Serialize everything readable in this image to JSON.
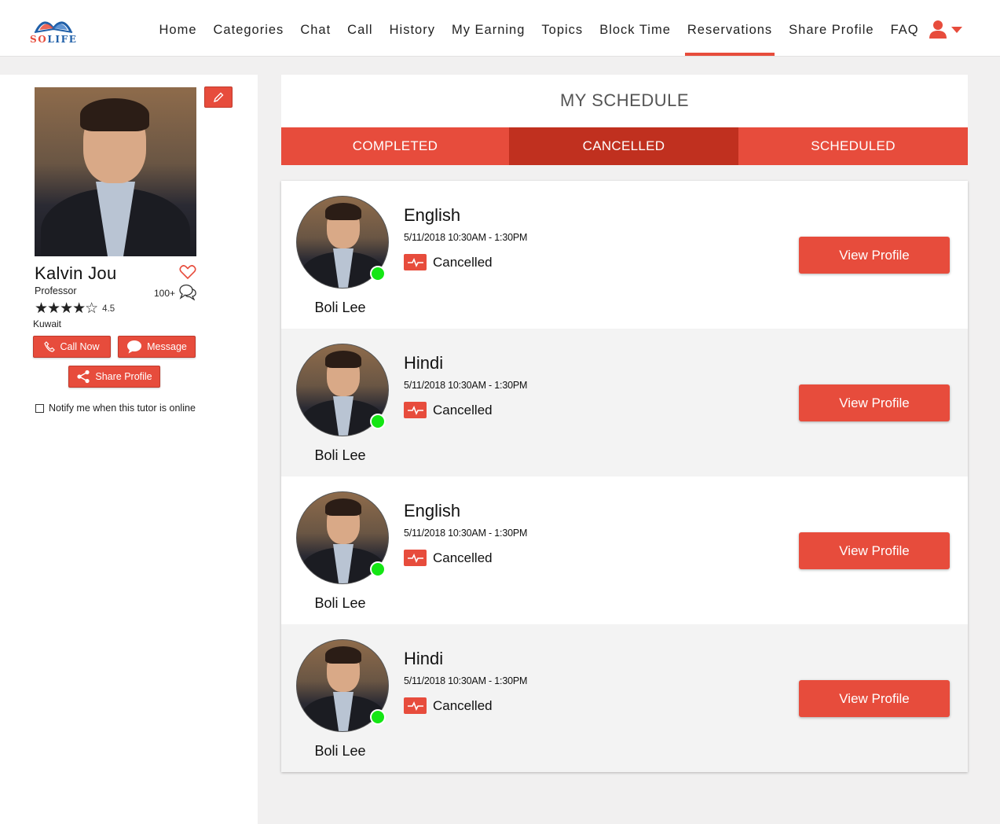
{
  "header": {
    "logo_text_a": "SO",
    "logo_text_b": "LIFE",
    "nav": [
      {
        "label": "Home"
      },
      {
        "label": "Categories"
      },
      {
        "label": "Chat"
      },
      {
        "label": "Call"
      },
      {
        "label": "History"
      },
      {
        "label": "My Earning"
      },
      {
        "label": "Topics"
      },
      {
        "label": "Block Time"
      },
      {
        "label": "Reservations"
      },
      {
        "label": "Share Profile"
      },
      {
        "label": "FAQ"
      }
    ],
    "active_nav": "Reservations",
    "user_icon": "user-icon"
  },
  "sidebar": {
    "name": "Kalvin Jou",
    "title": "Professor",
    "reviews": "100+",
    "stars": "★★★★☆",
    "rating": "4.5",
    "location": "Kuwait",
    "call_label": "Call Now",
    "message_label": "Message",
    "share_label": "Share Profile",
    "notify_label": "Notify me when this tutor is online"
  },
  "schedule": {
    "title": "MY SCHEDULE",
    "tabs": [
      {
        "label": "COMPLETED"
      },
      {
        "label": "CANCELLED"
      },
      {
        "label": "SCHEDULED"
      }
    ],
    "active_tab": "CANCELLED",
    "items": [
      {
        "student": "Boli Lee",
        "subject": "English",
        "datetime": "5/11/2018 10:30AM - 1:30PM",
        "status": "Cancelled",
        "button": "View Profile"
      },
      {
        "student": "Boli Lee",
        "subject": "Hindi",
        "datetime": "5/11/2018 10:30AM - 1:30PM",
        "status": "Cancelled",
        "button": "View Profile"
      },
      {
        "student": "Boli Lee",
        "subject": "English",
        "datetime": "5/11/2018 10:30AM - 1:30PM",
        "status": "Cancelled",
        "button": "View Profile"
      },
      {
        "student": "Boli Lee",
        "subject": "Hindi",
        "datetime": "5/11/2018 10:30AM - 1:30PM",
        "status": "Cancelled",
        "button": "View Profile"
      }
    ]
  },
  "colors": {
    "accent": "#e74c3c",
    "accent_dark": "#c0301f",
    "online": "#14e614",
    "logo_blue": "#1f5fa8"
  }
}
